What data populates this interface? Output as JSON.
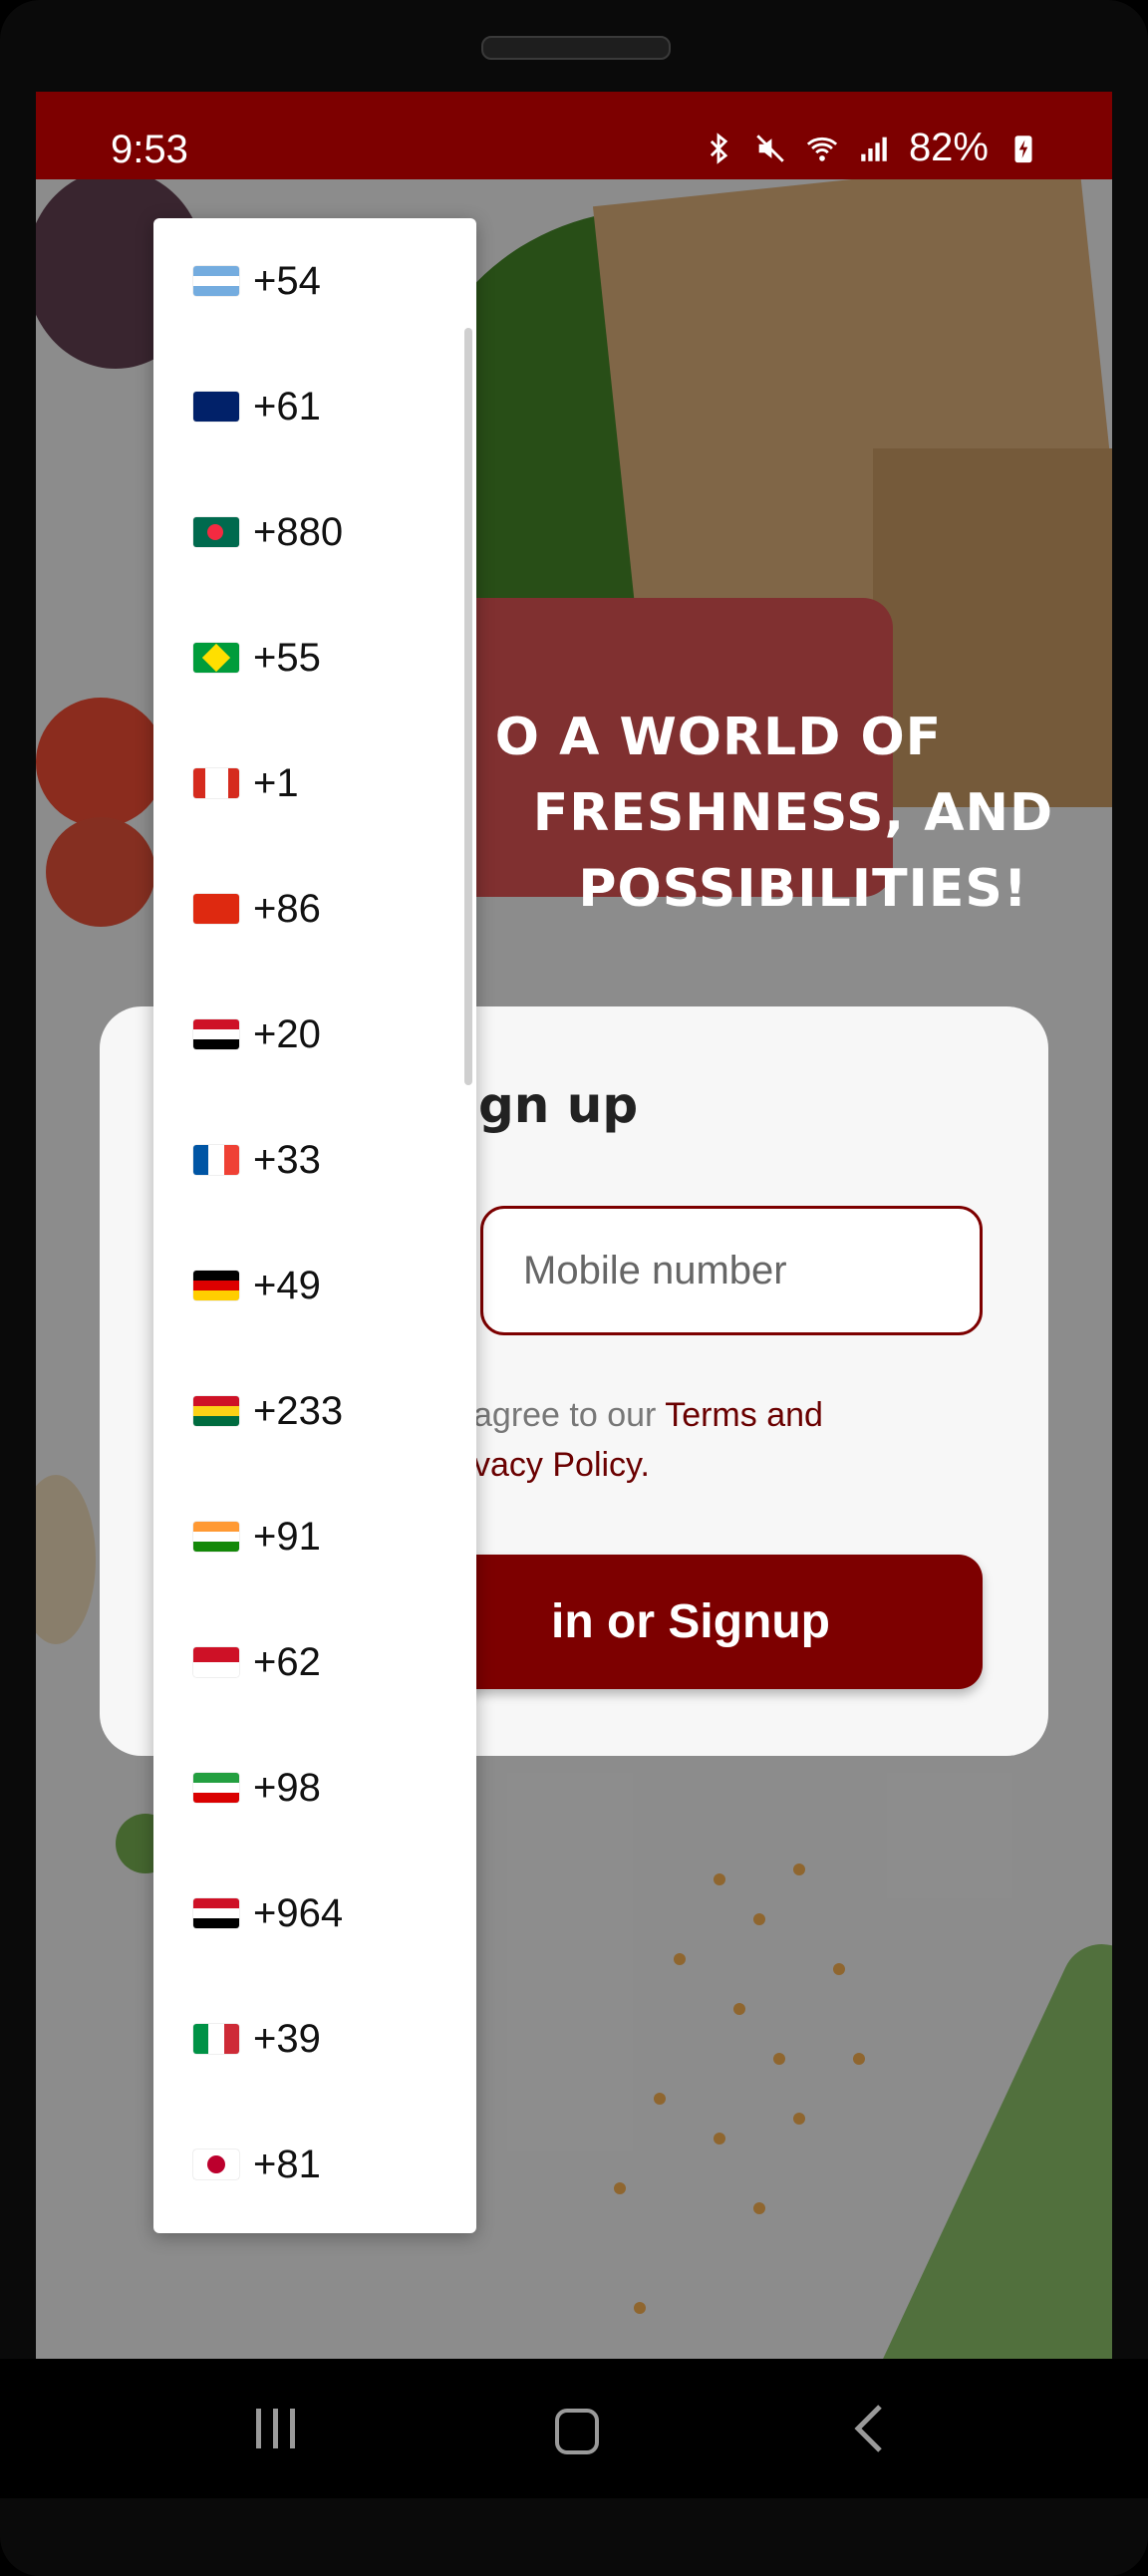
{
  "status_bar": {
    "time": "9:53",
    "battery": "82%",
    "icons": [
      "bluetooth-icon",
      "mute-icon",
      "wifi-icon",
      "signal-icon",
      "battery-charging-icon"
    ]
  },
  "headline": {
    "line1": "O A WORLD OF",
    "line2": "FRESHNESS, AND",
    "line3": "POSSIBILITIES!"
  },
  "card": {
    "title": "gn up",
    "mobile_placeholder": "Mobile number",
    "terms_prefix": "agree to our ",
    "terms_link": "Terms and",
    "privacy_link": "vacy Policy.",
    "button_label": "in or Signup"
  },
  "country_codes": [
    {
      "code": "+54",
      "flag": "argentina"
    },
    {
      "code": "+61",
      "flag": "australia"
    },
    {
      "code": "+880",
      "flag": "bangladesh"
    },
    {
      "code": "+55",
      "flag": "brazil"
    },
    {
      "code": "+1",
      "flag": "canada"
    },
    {
      "code": "+86",
      "flag": "china"
    },
    {
      "code": "+20",
      "flag": "egypt"
    },
    {
      "code": "+33",
      "flag": "france"
    },
    {
      "code": "+49",
      "flag": "germany"
    },
    {
      "code": "+233",
      "flag": "ghana"
    },
    {
      "code": "+91",
      "flag": "india"
    },
    {
      "code": "+62",
      "flag": "indonesia"
    },
    {
      "code": "+98",
      "flag": "iran"
    },
    {
      "code": "+964",
      "flag": "iraq"
    },
    {
      "code": "+39",
      "flag": "italy"
    },
    {
      "code": "+81",
      "flag": "japan"
    }
  ],
  "nav_bar": {
    "buttons": [
      "recent-apps-icon",
      "home-icon",
      "back-icon"
    ]
  },
  "colors": {
    "brand": "#7d0000",
    "card": "#ffffff"
  }
}
